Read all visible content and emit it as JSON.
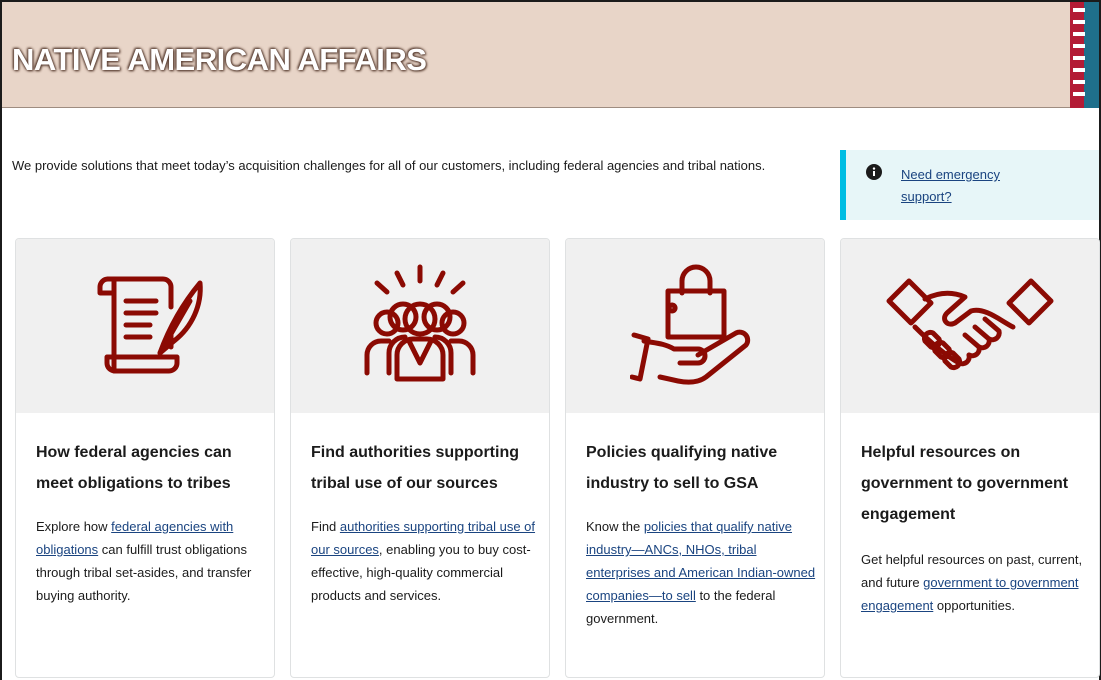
{
  "banner": {
    "title": "NATIVE AMERICAN AFFAIRS"
  },
  "intro": {
    "text": "We provide solutions that meet today’s acquisition challenges for all of our customers, including federal agencies and tribal nations."
  },
  "alert": {
    "link_text": "Need emergency support?",
    "icon": "info-icon"
  },
  "cards": [
    {
      "icon": "scroll-quill-icon",
      "title": "How federal agencies can meet obligations to tribes",
      "body_before": "Explore how ",
      "link_text": "federal agencies with obligations",
      "body_after": " can fulfill trust obligations through tribal set-asides, and transfer buying authority."
    },
    {
      "icon": "crowd-people-icon",
      "title": "Find authorities supporting tribal use of our sources",
      "body_before": "Find ",
      "link_text": "authorities supporting tribal use of our sources",
      "body_after": ", enabling you to buy cost-effective, high-quality commercial products and services."
    },
    {
      "icon": "hand-shopping-bag-icon",
      "title": "Policies qualifying native industry to sell to GSA",
      "body_before": "Know the ",
      "link_text": "policies that qualify native industry—ANCs, NHOs, tribal enterprises and American Indian-owned companies—to sell",
      "body_after": " to the federal government."
    },
    {
      "icon": "handshake-icon",
      "title": "Helpful resources on government to government engagement",
      "body_before": "Get helpful resources on past, current, and future ",
      "link_text": "government to government engagement",
      "body_after": " opportunities."
    }
  ],
  "colors": {
    "icon": "#8b0a03",
    "link": "#1a4480",
    "banner_bg": "#e8d5c8",
    "alert_border": "#00bde3"
  }
}
